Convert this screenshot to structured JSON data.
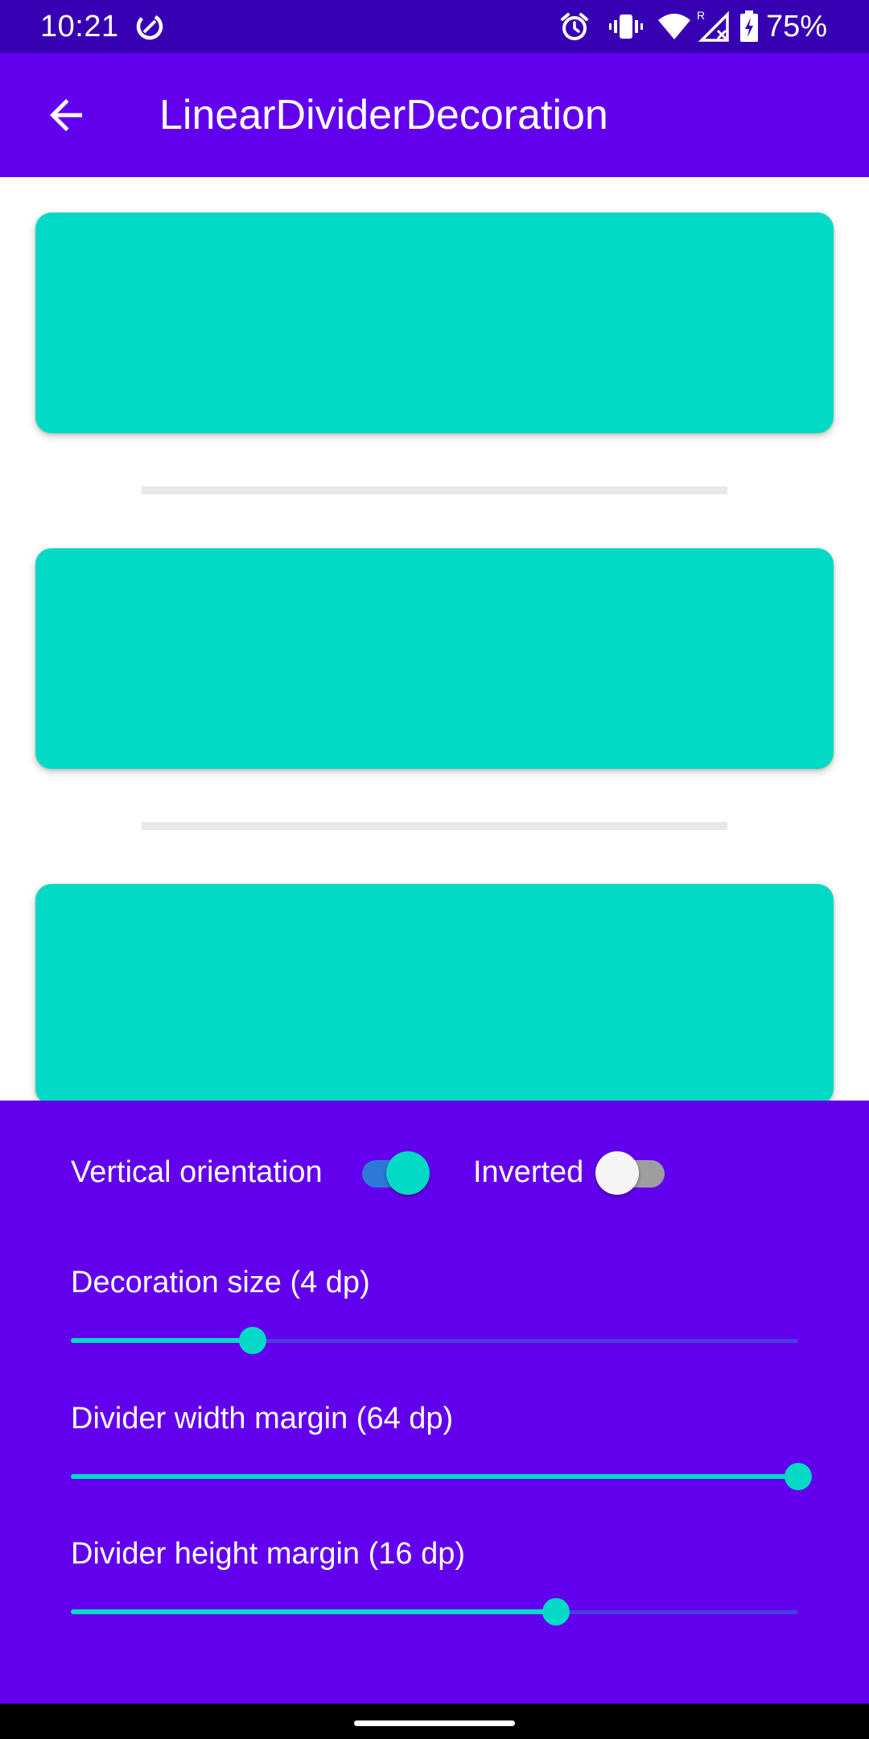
{
  "status_bar": {
    "time": "10:21",
    "battery_percent": "75%",
    "icons": [
      "data-saver-icon",
      "alarm-icon",
      "vibrate-icon",
      "wifi-icon",
      "signal-roaming-icon",
      "battery-charging-icon"
    ]
  },
  "app_bar": {
    "title": "LinearDividerDecoration",
    "back_icon": "arrow-back-icon"
  },
  "list": {
    "card_count": 3,
    "card_color": "#03dac5",
    "divider_color": "#e8e8e8"
  },
  "controls": {
    "vertical_orientation": {
      "label": "Vertical orientation",
      "checked": true
    },
    "inverted": {
      "label": "Inverted",
      "checked": false
    },
    "sliders": [
      {
        "label": "Decoration size (4 dp)",
        "fraction": 0.25
      },
      {
        "label": "Divider width margin (64 dp)",
        "fraction": 1.0
      },
      {
        "label": "Divider height margin (16 dp)",
        "fraction": 0.667
      }
    ]
  },
  "colors": {
    "primary": "#6200ee",
    "primary_dark": "#3700b3",
    "accent": "#03dac5"
  }
}
